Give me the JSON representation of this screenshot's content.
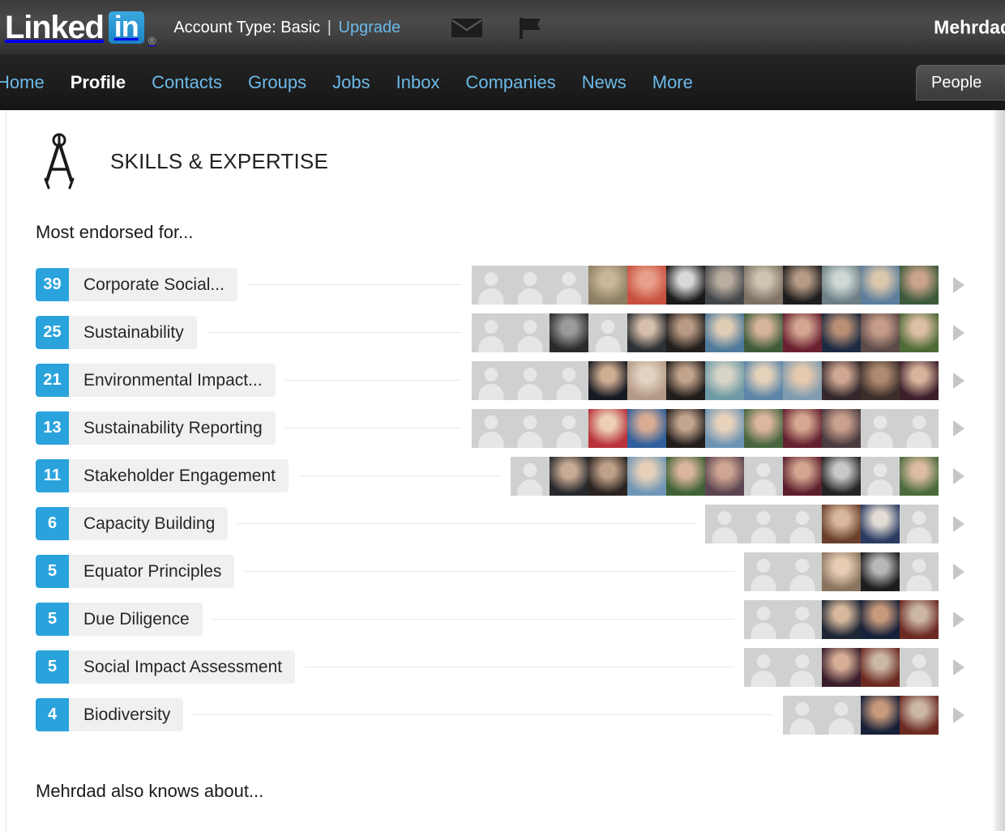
{
  "header": {
    "logo_word": "Linked",
    "logo_in": "in",
    "logo_registered": "®",
    "account_label": "Account Type:",
    "account_value": "Basic",
    "separator": "|",
    "upgrade_label": "Upgrade",
    "messages_icon": "envelope-icon",
    "flag_icon": "flag-icon",
    "user_name": "Mehrdad"
  },
  "nav": {
    "items": [
      {
        "label": "Home",
        "active": false
      },
      {
        "label": "Profile",
        "active": true
      },
      {
        "label": "Contacts",
        "active": false
      },
      {
        "label": "Groups",
        "active": false
      },
      {
        "label": "Jobs",
        "active": false
      },
      {
        "label": "Inbox",
        "active": false
      },
      {
        "label": "Companies",
        "active": false
      },
      {
        "label": "News",
        "active": false
      },
      {
        "label": "More",
        "active": false
      }
    ],
    "search_scope": "People"
  },
  "section": {
    "icon": "compass-divider-icon",
    "title": "SKILLS & EXPERTISE",
    "subhead": "Most endorsed for...",
    "footnote": "Mehrdad also knows about..."
  },
  "colors": {
    "count_badge": "#2aa3dd",
    "pill_background": "#f0f0f0",
    "nav_link": "#6cb9e8",
    "avatar_placeholder": "#cfd0d0"
  },
  "skills": [
    {
      "count": "39",
      "name": "Corporate Social...",
      "endorsers": [
        {
          "photo": false
        },
        {
          "photo": false
        },
        {
          "photo": false
        },
        {
          "photo": true,
          "c1": "#8d7f63",
          "c2": "#c9b79a"
        },
        {
          "photo": true,
          "c1": "#c8503f",
          "c2": "#e8a08a"
        },
        {
          "photo": true,
          "c1": "#1a1a1a",
          "c2": "#d8d8d8"
        },
        {
          "photo": true,
          "c1": "#44474a",
          "c2": "#b9ada0"
        },
        {
          "photo": true,
          "c1": "#7d7264",
          "c2": "#cfc3b2"
        },
        {
          "photo": true,
          "c1": "#1d1d1d",
          "c2": "#b59a85"
        },
        {
          "photo": true,
          "c1": "#6d7e85",
          "c2": "#cdd8d4"
        },
        {
          "photo": true,
          "c1": "#5b7e9c",
          "c2": "#dcc7ad"
        },
        {
          "photo": true,
          "c1": "#3c5a3a",
          "c2": "#caa38c"
        }
      ]
    },
    {
      "count": "25",
      "name": "Sustainability",
      "endorsers": [
        {
          "photo": false
        },
        {
          "photo": false
        },
        {
          "photo": true,
          "c1": "#2b2b2b",
          "c2": "#9a9a9a"
        },
        {
          "photo": false
        },
        {
          "photo": true,
          "c1": "#2d3035",
          "c2": "#d6c0ab"
        },
        {
          "photo": true,
          "c1": "#231f1c",
          "c2": "#b99b85"
        },
        {
          "photo": true,
          "c1": "#4f7a9b",
          "c2": "#e0cdb5"
        },
        {
          "photo": true,
          "c1": "#3f5c3a",
          "c2": "#d7b49c"
        },
        {
          "photo": true,
          "c1": "#6a2030",
          "c2": "#d4a692"
        },
        {
          "photo": true,
          "c1": "#1c2b42",
          "c2": "#b98f74"
        },
        {
          "photo": true,
          "c1": "#5c4a48",
          "c2": "#c59c8a"
        },
        {
          "photo": true,
          "c1": "#4e6b36",
          "c2": "#ddbfa4"
        }
      ]
    },
    {
      "count": "21",
      "name": "Environmental Impact...",
      "endorsers": [
        {
          "photo": false
        },
        {
          "photo": false
        },
        {
          "photo": false
        },
        {
          "photo": true,
          "c1": "#181a22",
          "c2": "#cfae92"
        },
        {
          "photo": true,
          "c1": "#b39a86",
          "c2": "#e3d3c2"
        },
        {
          "photo": true,
          "c1": "#211d1a",
          "c2": "#c2a38c"
        },
        {
          "photo": true,
          "c1": "#6d9aa4",
          "c2": "#d8d4c7"
        },
        {
          "photo": true,
          "c1": "#5d85a8",
          "c2": "#e4d2ba"
        },
        {
          "photo": true,
          "c1": "#7f9cb0",
          "c2": "#e6c9ae"
        },
        {
          "photo": true,
          "c1": "#33272b",
          "c2": "#cfa792"
        },
        {
          "photo": true,
          "c1": "#3b2f2a",
          "c2": "#b08a70"
        },
        {
          "photo": true,
          "c1": "#3d1f2c",
          "c2": "#d8b49c"
        }
      ]
    },
    {
      "count": "13",
      "name": "Sustainability Reporting",
      "endorsers": [
        {
          "photo": false
        },
        {
          "photo": false
        },
        {
          "photo": false
        },
        {
          "photo": true,
          "c1": "#b8323a",
          "c2": "#eccfb4"
        },
        {
          "photo": true,
          "c1": "#2f5f9c",
          "c2": "#d8ac93"
        },
        {
          "photo": true,
          "c1": "#241f1d",
          "c2": "#c3a68f"
        },
        {
          "photo": true,
          "c1": "#6d94b4",
          "c2": "#e8d2bb"
        },
        {
          "photo": true,
          "c1": "#47663f",
          "c2": "#dcb69e"
        },
        {
          "photo": true,
          "c1": "#63202f",
          "c2": "#d5a891"
        },
        {
          "photo": true,
          "c1": "#4a3b3f",
          "c2": "#c9a08e"
        },
        {
          "photo": false
        },
        {
          "photo": false
        }
      ]
    },
    {
      "count": "11",
      "name": "Stakeholder Engagement",
      "endorsers": [
        {
          "photo": false
        },
        {
          "photo": true,
          "c1": "#26282c",
          "c2": "#c8ab94"
        },
        {
          "photo": true,
          "c1": "#2a2320",
          "c2": "#bfa088"
        },
        {
          "photo": true,
          "c1": "#6f96b6",
          "c2": "#e6d0b8"
        },
        {
          "photo": true,
          "c1": "#3f6236",
          "c2": "#dab59c"
        },
        {
          "photo": true,
          "c1": "#5b4450",
          "c2": "#cfa693"
        },
        {
          "photo": false
        },
        {
          "photo": true,
          "c1": "#5e1f2d",
          "c2": "#d3a690"
        },
        {
          "photo": true,
          "c1": "#252525",
          "c2": "#c8c8c8"
        },
        {
          "photo": false
        },
        {
          "photo": true,
          "c1": "#4a6c3c",
          "c2": "#ddbda2"
        }
      ]
    },
    {
      "count": "6",
      "name": "Capacity Building",
      "endorsers": [
        {
          "photo": false
        },
        {
          "photo": false
        },
        {
          "photo": false
        },
        {
          "photo": true,
          "c1": "#6a402c",
          "c2": "#d8b79c"
        },
        {
          "photo": true,
          "c1": "#2a3b63",
          "c2": "#e2dcd4"
        },
        {
          "photo": false
        }
      ]
    },
    {
      "count": "5",
      "name": "Equator Principles",
      "endorsers": [
        {
          "photo": false
        },
        {
          "photo": false
        },
        {
          "photo": true,
          "c1": "#8a7460",
          "c2": "#e7cdb4"
        },
        {
          "photo": true,
          "c1": "#1c1c1c",
          "c2": "#b8b8b8"
        },
        {
          "photo": false
        }
      ]
    },
    {
      "count": "5",
      "name": "Due Diligence",
      "endorsers": [
        {
          "photo": false
        },
        {
          "photo": false
        },
        {
          "photo": true,
          "c1": "#1d2634",
          "c2": "#d7b89c"
        },
        {
          "photo": true,
          "c1": "#17203a",
          "c2": "#c89a7c"
        },
        {
          "photo": true,
          "c1": "#6c2a22",
          "c2": "#cbb7a4"
        }
      ]
    },
    {
      "count": "5",
      "name": "Social Impact Assessment",
      "endorsers": [
        {
          "photo": false
        },
        {
          "photo": false
        },
        {
          "photo": true,
          "c1": "#3a1d2c",
          "c2": "#d6ae96"
        },
        {
          "photo": true,
          "c1": "#6c2a22",
          "c2": "#cbb7a4"
        },
        {
          "photo": false
        }
      ]
    },
    {
      "count": "4",
      "name": "Biodiversity",
      "endorsers": [
        {
          "photo": false
        },
        {
          "photo": false
        },
        {
          "photo": true,
          "c1": "#17203a",
          "c2": "#c89a7c"
        },
        {
          "photo": true,
          "c1": "#6c2a22",
          "c2": "#cbb7a4"
        }
      ]
    }
  ]
}
